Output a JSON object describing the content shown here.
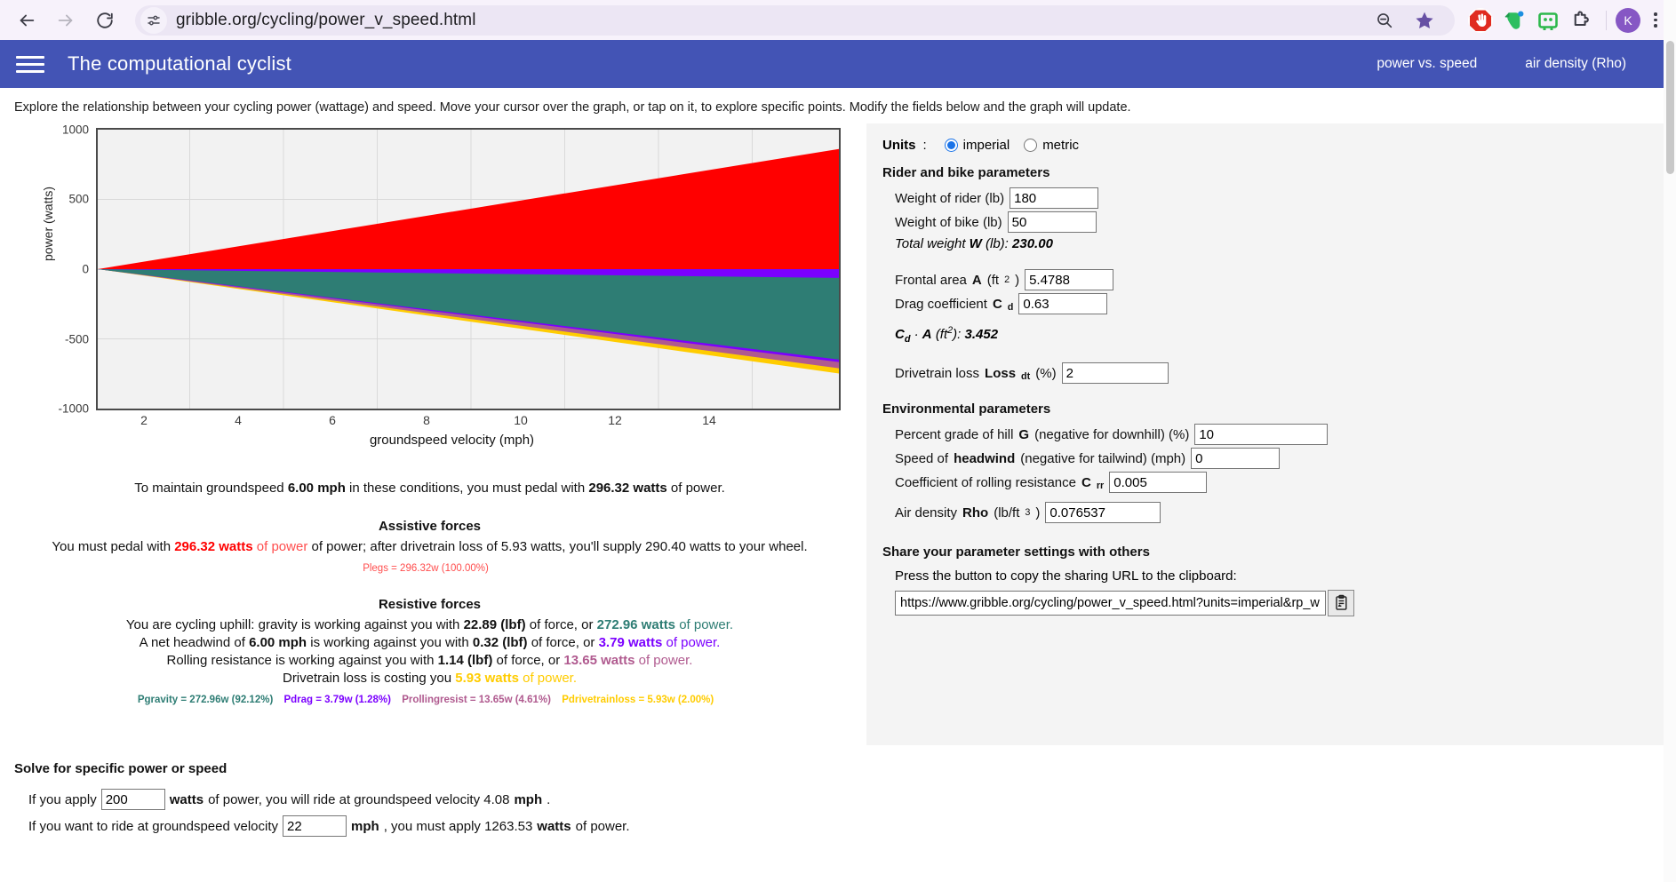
{
  "browser": {
    "back_icon": "back-arrow-icon",
    "forward_icon": "forward-arrow-icon",
    "reload_icon": "reload-icon",
    "url": "gribble.org/cycling/power_v_speed.html",
    "site_info_icon": "site-settings-icon",
    "zoom_out_icon": "zoom-out-icon",
    "bookmark_icon": "bookmark-star-icon",
    "extensions": [
      {
        "name": "adblock-icon",
        "color": "#d93025"
      },
      {
        "name": "evernote-icon",
        "color": "#2dbe60"
      },
      {
        "name": "password-manager-icon",
        "color": "#2db84c"
      },
      {
        "name": "extensions-puzzle-icon",
        "color": "#3c3c46"
      }
    ],
    "avatar_letter": "K",
    "menu_icon": "kebab-menu-icon"
  },
  "navbar": {
    "menu_icon": "hamburger-menu-icon",
    "brand": "The computational cyclist",
    "links": [
      {
        "label": "power vs. speed"
      },
      {
        "label": "air density (Rho)"
      }
    ],
    "bg_color": "#4354b5"
  },
  "intro": "Explore the relationship between your cycling power (wattage) and speed. Move your cursor over the graph, or tap on it, to explore specific points. Modify the fields below and the graph will update.",
  "chart_data": {
    "type": "area",
    "title": "",
    "xlabel": "groundspeed velocity (mph)",
    "ylabel": "power (watts)",
    "xlim": [
      0.5,
      15.4
    ],
    "ylim": [
      -1000,
      1000
    ],
    "xticks": [
      2,
      4,
      6,
      8,
      10,
      12,
      14
    ],
    "yticks": [
      -1000,
      -500,
      0,
      500,
      1000
    ],
    "grid": true,
    "legend_position": "none",
    "x": [
      0.5,
      15.4
    ],
    "series": [
      {
        "name": "Plegs",
        "color": "#ff0000",
        "values_at_xmin": 0,
        "values_at_xmax": 860,
        "note": "assistive pedal power, filled above zero"
      },
      {
        "name": "Pgravity",
        "color": "#2e7d74",
        "values_at_xmin": 0,
        "values_at_xmax": -700,
        "note": "gravity resistance, filled below zero"
      },
      {
        "name": "Pdrag",
        "color": "#7b00ff",
        "values_at_xmin": 0,
        "values_at_xmax": -65,
        "note": "aero drag band stacked just below zero"
      },
      {
        "name": "Prollingresist",
        "color": "#b05a8f",
        "values_at_xmin": 0,
        "values_at_xmax": -735,
        "note": "rolling resistance thin band at stack bottom"
      },
      {
        "name": "Pdrivetrainloss",
        "color": "#ffcc00",
        "values_at_xmin": 0,
        "values_at_xmax": -750,
        "note": "drivetrain loss thin band at stack bottom"
      }
    ]
  },
  "results": {
    "maintain_pre": "To maintain groundspeed ",
    "maintain_speed": "6.00 mph",
    "maintain_mid": " in these conditions, you must pedal with ",
    "maintain_power": "296.32 watts",
    "maintain_post": " of power.",
    "assistive_heading": "Assistive forces",
    "assistive_pre": "You must pedal with ",
    "assistive_power": "296.32 watts",
    "assistive_mid": " of power; after drivetrain loss of 5.93 watts, you'll supply 290.40 watts to your wheel.",
    "plegs_summary": "Plegs = 296.32w (100.00%)",
    "resistive_heading": "Resistive forces",
    "gravity_pre": "You are cycling uphill: gravity is working against you with ",
    "gravity_force": "22.89 (lbf)",
    "gravity_mid": " of force, or ",
    "gravity_power": "272.96 watts",
    "gravity_post": " of power.",
    "wind_pre": "A net headwind of ",
    "wind_speed": "6.00 mph",
    "wind_mid": " is working against you with ",
    "wind_force": "0.32 (lbf)",
    "wind_mid2": " of force, or ",
    "wind_power": "3.79 watts",
    "wind_post": " of power.",
    "roll_pre": "Rolling resistance is working against you with ",
    "roll_force": "1.14 (lbf)",
    "roll_mid": " of force, or ",
    "roll_power": "13.65 watts",
    "roll_post": " of power.",
    "dt_pre": "Drivetrain loss is costing you ",
    "dt_power": "5.93 watts",
    "dt_post": " of power.",
    "summary": {
      "gravity": "Pgravity = 272.96w (92.12%)",
      "drag": "Pdrag = 3.79w (1.28%)",
      "rolling": "Prollingresist = 13.65w (4.61%)",
      "drivetrain": "Pdrivetrainloss = 5.93w (2.00%)"
    }
  },
  "panel": {
    "units_label": "Units",
    "units_colon": ":",
    "unit_imperial": "imperial",
    "unit_metric": "metric",
    "units_selected": "imperial",
    "rider_heading": "Rider and bike parameters",
    "weight_rider_label": "Weight of rider (lb)",
    "weight_rider_value": "180",
    "weight_bike_label": "Weight of bike (lb)",
    "weight_bike_value": "50",
    "total_weight_label": "Total weight",
    "total_weight_sym": "W",
    "total_weight_unit": "(lb):",
    "total_weight_value": "230.00",
    "frontal_area_label": "Frontal area",
    "frontal_area_sym": "A",
    "frontal_area_unit_pre": "(ft",
    "frontal_area_unit_sup": "2",
    "frontal_area_unit_post": ")",
    "frontal_area_value": "5.4788",
    "drag_coef_label": "Drag coefficient",
    "drag_coef_sym": "C",
    "drag_coef_sub": "d",
    "drag_coef_value": "0.63",
    "cda_label_c": "C",
    "cda_label_csub": "d",
    "cda_dot": "·",
    "cda_label_a": "A",
    "cda_unit_pre": "(ft",
    "cda_unit_sup": "2",
    "cda_unit_post": "):",
    "cda_value": "3.452",
    "drivetrain_label": "Drivetrain loss",
    "drivetrain_sym": "Loss",
    "drivetrain_sub": "dt",
    "drivetrain_unit": "(%)",
    "drivetrain_value": "2",
    "env_heading": "Environmental parameters",
    "grade_label_pre": "Percent grade of hill",
    "grade_sym": "G",
    "grade_label_post": "(negative for downhill) (%)",
    "grade_value": "10",
    "headwind_label_pre": "Speed of",
    "headwind_sym": "headwind",
    "headwind_label_post": "(negative for tailwind) (mph)",
    "headwind_value": "0",
    "crr_label": "Coefficient of rolling resistance",
    "crr_sym": "C",
    "crr_sub": "rr",
    "crr_value": "0.005",
    "rho_label_pre": "Air density",
    "rho_sym": "Rho",
    "rho_unit_pre": "(lb/ft",
    "rho_unit_sup": "3",
    "rho_unit_post": ")",
    "rho_value": "0.076537",
    "share_heading": "Share your parameter settings with others",
    "share_instruction": "Press the button to copy the sharing URL to the clipboard:",
    "share_url": "https://www.gribble.org/cycling/power_v_speed.html?units=imperial&rp_w",
    "copy_icon": "copy-to-clipboard-icon"
  },
  "solver": {
    "heading": "Solve for specific power or speed",
    "line1_pre": "If you apply",
    "line1_value": "200",
    "line1_unit": "watts",
    "line1_post": "of power, you will ride at groundspeed velocity 4.08",
    "line1_end": "mph",
    "line1_period": ".",
    "line2_pre": "If you want to ride at groundspeed velocity",
    "line2_value": "22",
    "line2_unit": "mph",
    "line2_post": ", you must apply 1263.53",
    "line2_unit2": "watts",
    "line2_end": "of power."
  }
}
